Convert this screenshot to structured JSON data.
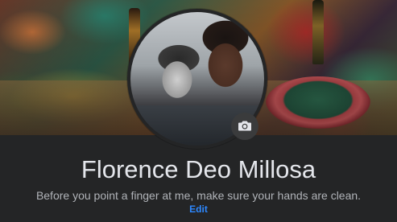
{
  "profile": {
    "name": "Florence Deo Millosa",
    "bio": "Before you point a finger at me, make sure your hands are clean.",
    "edit_label": "Edit"
  },
  "icons": {
    "camera": "camera-icon"
  },
  "colors": {
    "background": "#242526",
    "name_text": "#e4e6eb",
    "bio_text": "#b0b3b8",
    "link": "#2d88ff",
    "camera_button": "#3a3b3c"
  }
}
